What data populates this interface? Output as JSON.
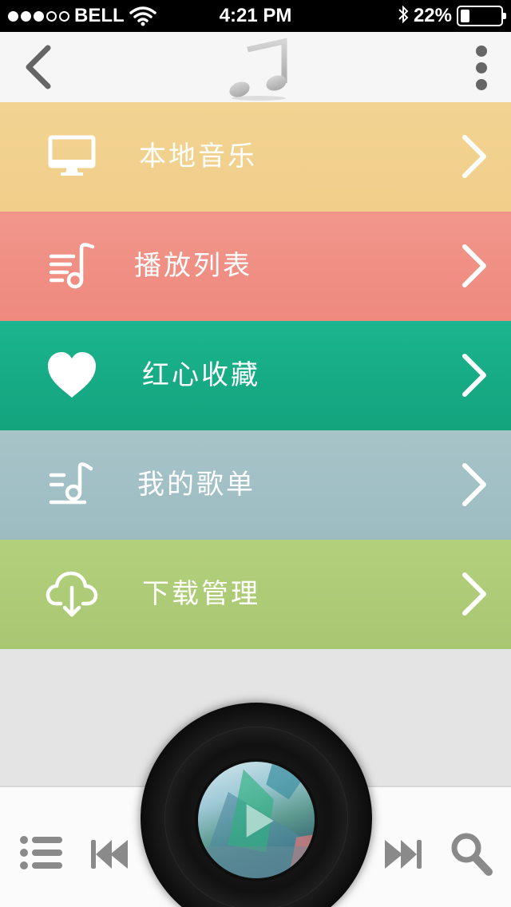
{
  "status_bar": {
    "carrier": "BELL",
    "signal_bars_filled": 3,
    "signal_bars_total": 5,
    "time": "4:21 PM",
    "battery_percent_text": "22%",
    "battery_level": 0.22
  },
  "nav_bar": {
    "back_icon": "chevron-left-icon",
    "logo_icon": "music-note-icon",
    "more_icon": "vertical-dots-icon"
  },
  "menu": {
    "items": [
      {
        "label": "本地音乐",
        "icon": "monitor-icon",
        "color": "#f2d28f"
      },
      {
        "label": "播放列表",
        "icon": "playlist-note-icon",
        "color": "#f0908a"
      },
      {
        "label": "红心收藏",
        "icon": "heart-icon",
        "color": "#17ad86"
      },
      {
        "label": "我的歌单",
        "icon": "my-songlist-icon",
        "color": "#a2c0c5"
      },
      {
        "label": "下载管理",
        "icon": "cloud-download-icon",
        "color": "#aecc77"
      }
    ]
  },
  "player": {
    "controls": [
      "list-icon",
      "previous-icon",
      "play-icon",
      "next-icon",
      "search-icon"
    ]
  }
}
